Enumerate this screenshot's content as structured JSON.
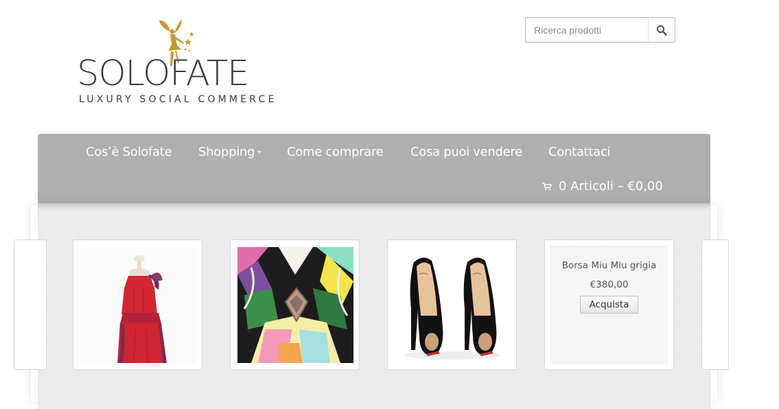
{
  "brand": {
    "name": "SOLOFATE",
    "tagline": "LUXURY SOCIAL COMMERCE"
  },
  "search": {
    "placeholder": "Ricerca prodotti",
    "icon": "search-icon"
  },
  "nav": {
    "items": [
      {
        "label": "Cos’è Solofate"
      },
      {
        "label": "Shopping"
      },
      {
        "label": "Come comprare"
      },
      {
        "label": "Cosa puoi vendere"
      },
      {
        "label": "Contattaci"
      }
    ],
    "cart": {
      "label": "0 Articoli – €0,00",
      "icon": "cart-icon"
    }
  },
  "products": [
    {
      "image": "red-dress"
    },
    {
      "image": "printed-dress"
    },
    {
      "image": "black-peep-toe-heels"
    },
    {
      "title": "Borsa Miu Miu grigia",
      "price": "€380,00",
      "button": "Acquista"
    }
  ],
  "colors": {
    "nav_bg": "#afafaf",
    "logo_gold": "#c99a2e",
    "text_dark": "#3c3c3c"
  }
}
